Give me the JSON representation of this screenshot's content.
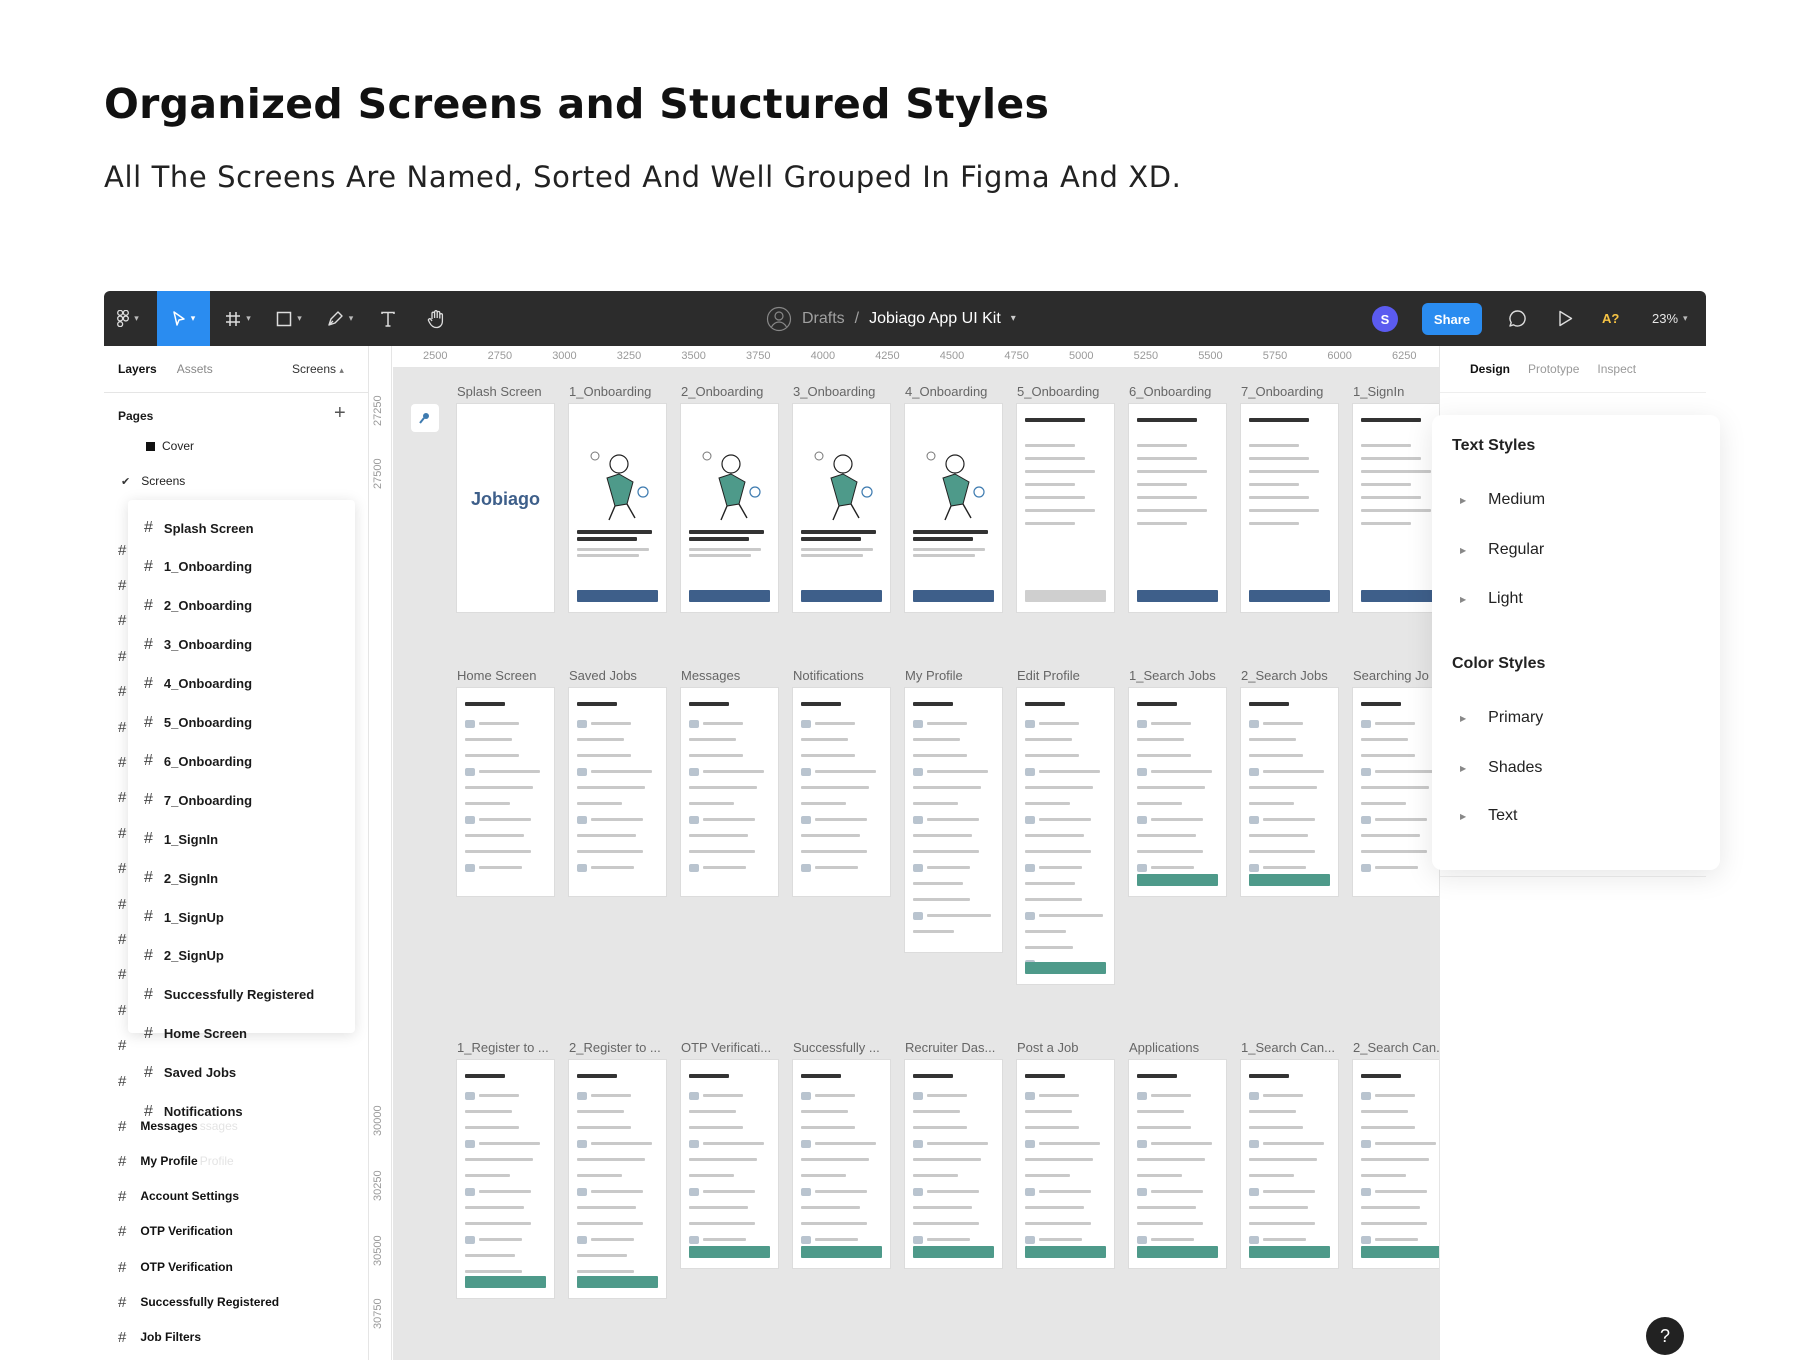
{
  "headline": "Organized Screens and Stuctured Styles",
  "subline": "All The Screens Are Named, Sorted And Well Grouped In Figma And XD.",
  "toolbar": {
    "breadcrumb_parent": "Drafts",
    "breadcrumb_sep": "/",
    "file_name": "Jobiago App UI Kit",
    "avatar_letter": "S",
    "share_label": "Share",
    "accessibility_label": "A?",
    "zoom_label": "23%"
  },
  "left_panel": {
    "tab_layers": "Layers",
    "tab_assets": "Assets",
    "page_selector": "Screens",
    "pages_title": "Pages",
    "pages": [
      "Cover",
      "Screens"
    ],
    "layers": [
      "Messages",
      "My Profile",
      "Account Settings",
      "OTP Verification",
      "OTP Verification",
      "Successfully Registered",
      "Job Filters"
    ],
    "ghost_text": [
      "ssages",
      "Profile"
    ]
  },
  "dropdown": {
    "items": [
      "Splash Screen",
      "1_Onboarding",
      "2_Onboarding",
      "3_Onboarding",
      "4_Onboarding",
      "5_Onboarding",
      "6_Onboarding",
      "7_Onboarding",
      "1_SignIn",
      "2_SignIn",
      "1_SignUp",
      "2_SignUp",
      "Successfully Registered",
      "Home Screen",
      "Saved Jobs",
      "Notifications"
    ]
  },
  "rulers": {
    "horizontal": [
      "2500",
      "2750",
      "3000",
      "3250",
      "3500",
      "3750",
      "4000",
      "4250",
      "4500",
      "4750",
      "5000",
      "5250",
      "5500",
      "5750",
      "6000",
      "6250"
    ],
    "vertical": [
      "27250",
      "27500",
      "30000",
      "30250",
      "30500",
      "30750"
    ]
  },
  "canvas": {
    "logo_text": "Jobiago",
    "row1": [
      "Splash Screen",
      "1_Onboarding",
      "2_Onboarding",
      "3_Onboarding",
      "4_Onboarding",
      "5_Onboarding",
      "6_Onboarding",
      "7_Onboarding",
      "1_SignIn"
    ],
    "row2": [
      "Home Screen",
      "Saved Jobs",
      "Messages",
      "Notifications",
      "My Profile",
      "Edit Profile",
      "1_Search Jobs",
      "2_Search Jobs",
      "Searching Jo"
    ],
    "row3": [
      "1_Register to ...",
      "2_Register to ...",
      "OTP Verificati...",
      "Successfully ...",
      "Recruiter Das...",
      "Post a Job",
      "Applications",
      "1_Search Can...",
      "2_Search Can..."
    ]
  },
  "right_panel": {
    "tab_design": "Design",
    "tab_prototype": "Prototype",
    "tab_inspect": "Inspect"
  },
  "styles_panel": {
    "text_styles_title": "Text Styles",
    "text_styles": [
      "Medium",
      "Regular",
      "Light"
    ],
    "color_styles_title": "Color Styles",
    "color_styles": [
      "Primary",
      "Shades",
      "Text"
    ]
  },
  "help_label": "?",
  "colors": {
    "toolbar_bg": "#2c2c2c",
    "accent_blue": "#2a8cf0",
    "brand": "#3e5f8a",
    "teal": "#4e9a8a"
  }
}
